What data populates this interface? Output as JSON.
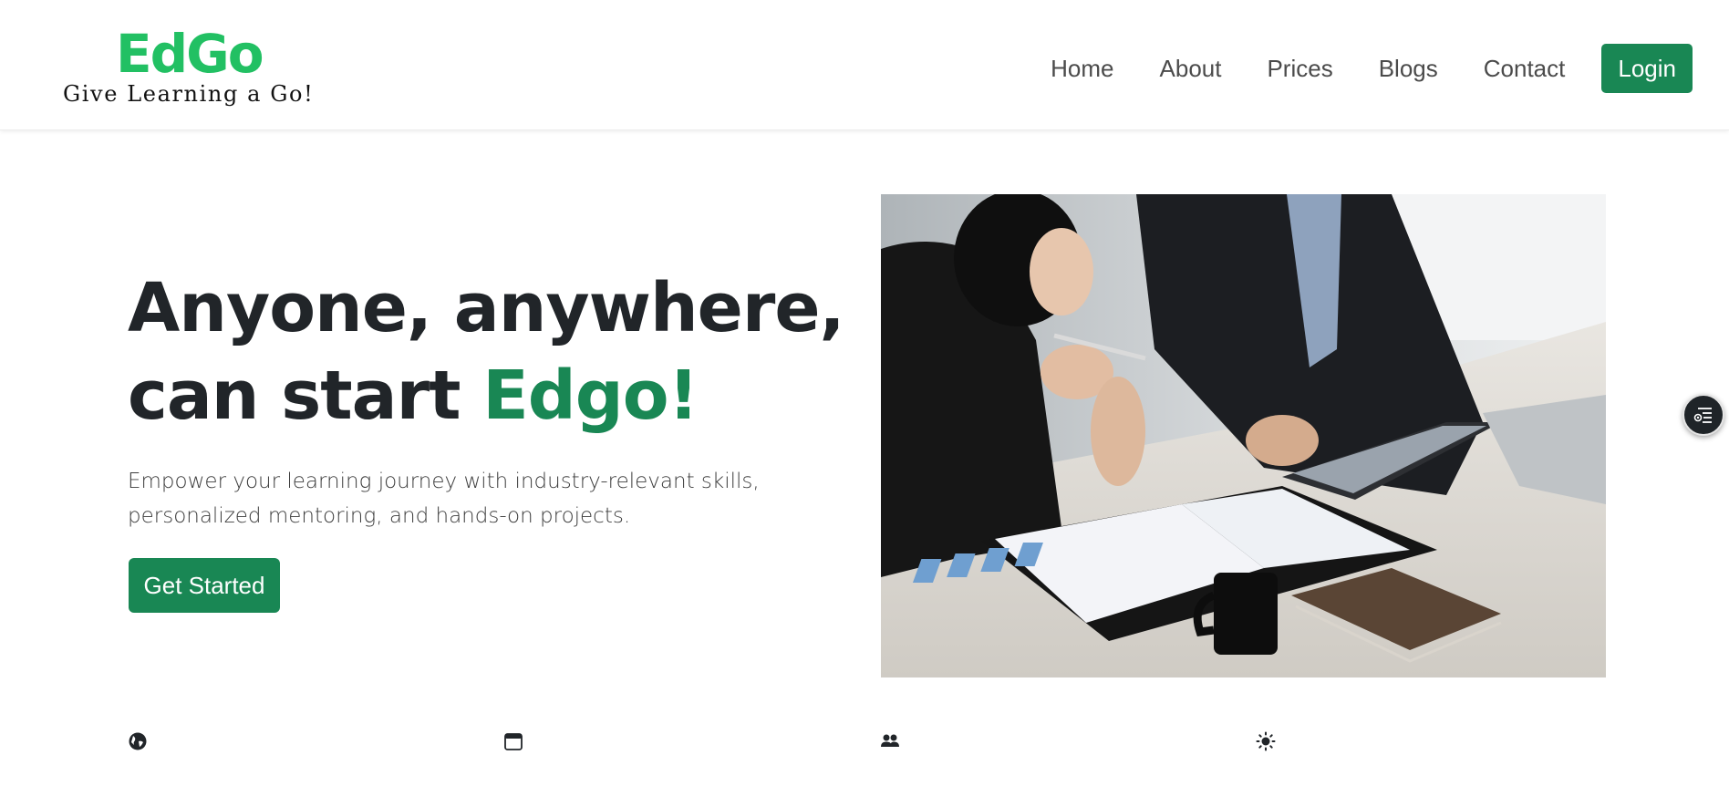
{
  "header": {
    "logo": {
      "mark": "EdGo",
      "tagline": "Give Learning a Go!"
    },
    "nav": [
      {
        "label": "Home"
      },
      {
        "label": "About"
      },
      {
        "label": "Prices"
      },
      {
        "label": "Blogs"
      },
      {
        "label": "Contact"
      }
    ],
    "login_label": "Login"
  },
  "hero": {
    "title_line1": "Anyone, anywhere,",
    "title_line2_prefix": "can start ",
    "title_accent": "Edgo!",
    "subtitle": "Empower your learning journey with industry-relevant skills, personalized mentoring, and hands-on projects.",
    "cta_label": "Get Started",
    "image_icon": "photo-business-meeting"
  },
  "floating_button": {
    "icon": "settings-list-icon"
  },
  "features": [
    {
      "icon": "globe-icon"
    },
    {
      "icon": "calendar-icon"
    },
    {
      "icon": "people-icon"
    },
    {
      "icon": "sun-icon"
    }
  ],
  "colors": {
    "brand_green": "#198754",
    "logo_green": "#22c063",
    "text_dark": "#212529"
  }
}
